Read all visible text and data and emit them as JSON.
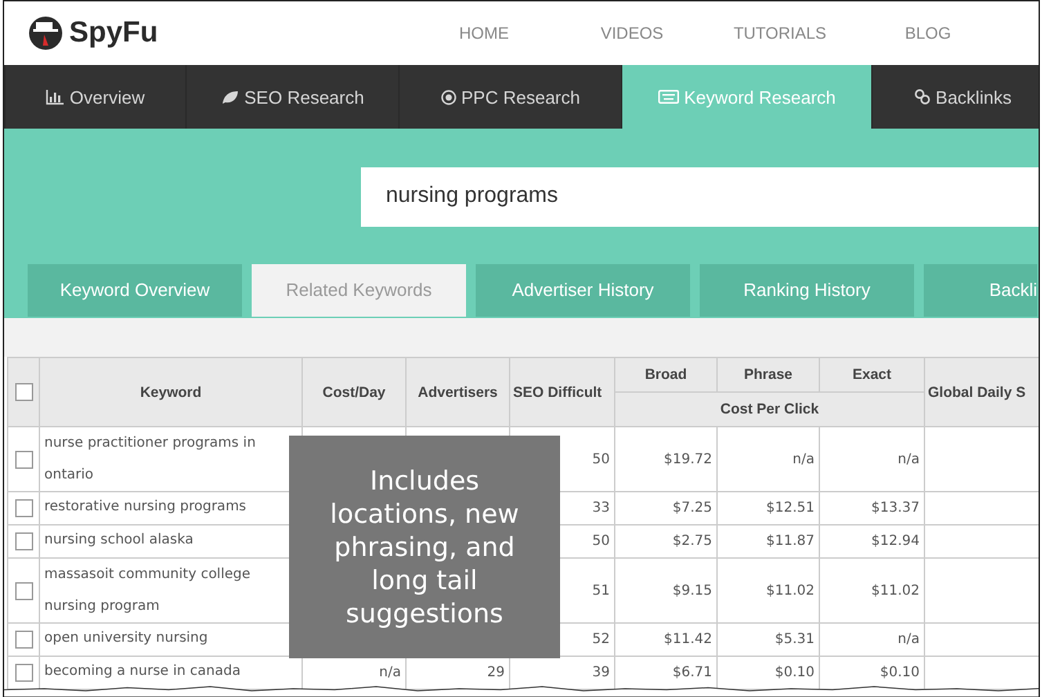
{
  "logo": {
    "text": "SpyFu"
  },
  "top_nav": [
    "HOME",
    "VIDEOS",
    "TUTORIALS",
    "BLOG"
  ],
  "main_tabs": [
    {
      "label": "Overview",
      "selected": false
    },
    {
      "label": "SEO Research",
      "selected": false
    },
    {
      "label": "PPC Research",
      "selected": false
    },
    {
      "label": "Keyword Research",
      "selected": true
    },
    {
      "label": "Backlinks",
      "selected": false
    }
  ],
  "search": {
    "value": "nursing programs"
  },
  "sub_tabs": [
    {
      "label": "Keyword Overview",
      "selected": false
    },
    {
      "label": "Related Keywords",
      "selected": true
    },
    {
      "label": "Advertiser History",
      "selected": false
    },
    {
      "label": "Ranking History",
      "selected": false
    },
    {
      "label": "Backli",
      "selected": false
    }
  ],
  "table": {
    "select_all": {
      "checked": false
    },
    "columns": [
      "Keyword",
      "Cost/Day",
      "Advertisers",
      "SEO Difficult",
      "Broad",
      "Phrase",
      "Exact",
      "Global Daily S"
    ],
    "group_header": "Cost Per Click",
    "rows": [
      {
        "checked": false,
        "keyword": "nurse practitioner programs in ontario",
        "seo": "50",
        "broad": "$19.72",
        "phrase": "n/a",
        "exact": "n/a"
      },
      {
        "checked": false,
        "keyword": "restorative nursing programs",
        "seo": "33",
        "broad": "$7.25",
        "phrase": "$12.51",
        "exact": "$13.37"
      },
      {
        "checked": false,
        "keyword": "nursing school alaska",
        "seo": "50",
        "broad": "$2.75",
        "phrase": "$11.87",
        "exact": "$12.94"
      },
      {
        "checked": false,
        "keyword": "massasoit community college nursing program",
        "seo": "51",
        "broad": "$9.15",
        "phrase": "$11.02",
        "exact": "$11.02"
      },
      {
        "checked": false,
        "keyword": "open university nursing",
        "seo": "52",
        "broad": "$11.42",
        "phrase": "$5.31",
        "exact": "n/a"
      },
      {
        "checked": false,
        "keyword": "becoming a nurse in canada",
        "cost_day": "n/a",
        "advertisers": "29",
        "seo": "39",
        "broad": "$6.71",
        "phrase": "$0.10",
        "exact": "$0.10"
      }
    ]
  },
  "callout": {
    "text": "Includes locations, new phrasing, and long tail suggestions"
  }
}
